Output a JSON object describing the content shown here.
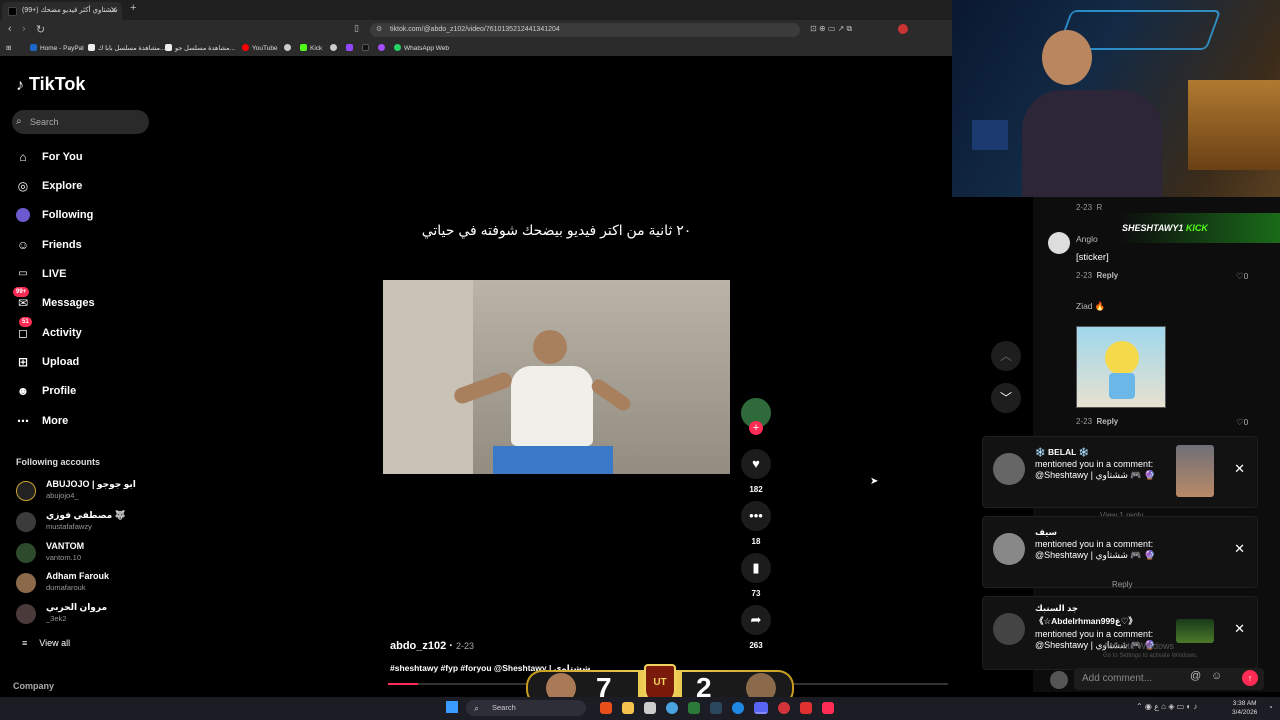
{
  "browser": {
    "tab_title": "(99+) ششتاوي أكثر فيديو مضحك",
    "url": "tiktok.com/@abdo_z102/video/7610135212441341204",
    "bookmarks": [
      "Home - PayPal",
      "مشاهدة مسلسل بابا ك...",
      "مشاهدة مسلسل جو...",
      "YouTube",
      "Kick",
      "WhatsApp Web"
    ]
  },
  "sidebar": {
    "logo": "TikTok",
    "search_placeholder": "Search",
    "nav": [
      {
        "label": "For You",
        "icon": "home-icon"
      },
      {
        "label": "Explore",
        "icon": "compass-icon"
      },
      {
        "label": "Following",
        "icon": "following-avatar-icon"
      },
      {
        "label": "Friends",
        "icon": "friends-icon"
      },
      {
        "label": "LIVE",
        "icon": "live-icon"
      },
      {
        "label": "Messages",
        "icon": "messages-icon",
        "badge": "99+"
      },
      {
        "label": "Activity",
        "icon": "activity-icon",
        "badge": "51"
      },
      {
        "label": "Upload",
        "icon": "upload-icon"
      },
      {
        "label": "Profile",
        "icon": "profile-icon"
      },
      {
        "label": "More",
        "icon": "more-icon"
      }
    ],
    "following_title": "Following accounts",
    "accounts": [
      {
        "name": "ABUJOJO | ابو جوجو",
        "handle": "abujojo4_"
      },
      {
        "name": "مصطفي فوزي 🐺",
        "handle": "mustafafawzy"
      },
      {
        "name": "VANTOM",
        "handle": "vantom.10"
      },
      {
        "name": "Adham Farouk",
        "handle": "dumafarouk"
      },
      {
        "name": "مروان الحربي",
        "handle": "_3ek2"
      }
    ],
    "view_all": "View all",
    "company": "Company"
  },
  "video": {
    "caption": "٢٠ ثانية من اكتر فيديو بيضحك شوفته في حياتي",
    "author": "abdo_z102",
    "date": "2-23",
    "tags": "#sheshtawy #fyp #foryou @Sheshtawy | ششتاوي",
    "more": "more",
    "likes": "182",
    "comments": "18",
    "saves": "73",
    "shares": "263"
  },
  "stream_overlay": {
    "kick_name": "SHESHTAWY1",
    "kick_label": "KICK",
    "score_left": "7",
    "score_right": "2"
  },
  "comments": {
    "items": [
      {
        "date": "2-23",
        "name": "Anglo",
        "text": "[sticker]",
        "reply": "Reply",
        "likes": "0"
      },
      {
        "date": "2-23",
        "name": "Ziad 🔥",
        "text": "",
        "reply": "Reply",
        "likes": "0"
      }
    ],
    "view_replies": "View 1 reply",
    "reply_fragment": "Reply",
    "input_placeholder": "Add comment...",
    "watermark_line1": "Activate Windows",
    "watermark_line2": "Go to Settings to activate Windows."
  },
  "notifications": [
    {
      "name": "❄️ BELAL ❄️",
      "text": "mentioned you in a comment: @Sheshtawy | ششتاوي 🎮 🔮"
    },
    {
      "name": "سيف",
      "text": "mentioned you in a comment: @Sheshtawy | ششتاوي 🎮 🔮"
    },
    {
      "name": "جد السنبك",
      "extra": "《☆Abdelrhmanغ999♡》",
      "text": "mentioned you in a comment: @Sheshtawy | ششتاوي 🎮 🔮"
    }
  ],
  "taskbar": {
    "search": "Search",
    "time": "3:38 AM",
    "date": "3/4/2026"
  }
}
